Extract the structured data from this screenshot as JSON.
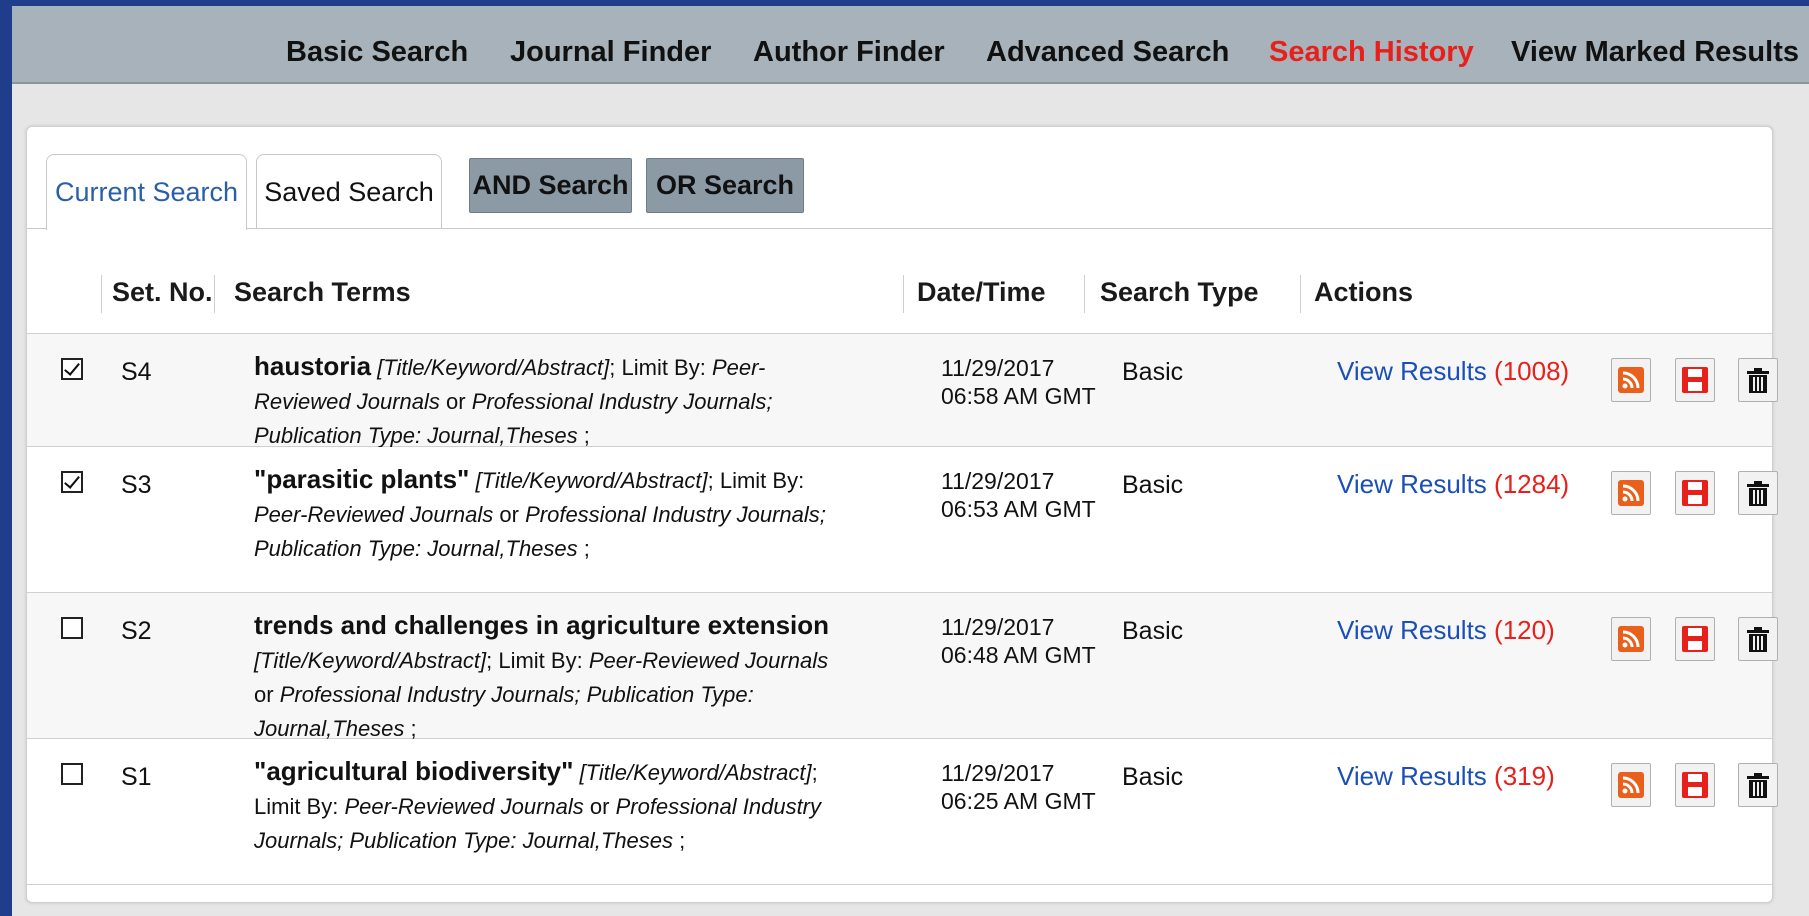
{
  "nav": {
    "items": [
      {
        "label": "Basic Search"
      },
      {
        "label": "Journal Finder"
      },
      {
        "label": "Author Finder"
      },
      {
        "label": "Advanced Search"
      },
      {
        "label": "Search History"
      },
      {
        "label": "View Marked Results"
      }
    ],
    "active": "Search History"
  },
  "tabs": {
    "current": "Current Search",
    "saved": "Saved Search",
    "and_button": "AND Search",
    "or_button": "OR Search"
  },
  "table": {
    "headers": {
      "set_no": "Set. No.",
      "search_terms": "Search Terms",
      "datetime": "Date/Time",
      "search_type": "Search Type",
      "actions": "Actions"
    },
    "rows": [
      {
        "checked": true,
        "set": "S4",
        "term": "haustoria",
        "fields": "[Title/Keyword/Abstract]",
        "limit_label": "; Limit By:",
        "limit1": "Peer-Reviewed Journals",
        "or": "or",
        "limit2": "Professional Industry Journals",
        "pubtype": "; Publication Type: Journal,Theses",
        "tail": ";",
        "date": "11/29/2017",
        "time": "06:58 AM GMT",
        "type": "Basic",
        "view": "View Results",
        "count": "(1008)"
      },
      {
        "checked": true,
        "set": "S3",
        "term": "\"parasitic plants\"",
        "fields": "[Title/Keyword/Abstract]",
        "limit_label": "; Limit By:",
        "limit1": "Peer-Reviewed Journals",
        "or": "or",
        "limit2": "Professional Industry Journals",
        "pubtype": "; Publication Type: Journal,Theses",
        "tail": ";",
        "date": "11/29/2017",
        "time": "06:53 AM GMT",
        "type": "Basic",
        "view": "View Results",
        "count": "(1284)"
      },
      {
        "checked": false,
        "set": "S2",
        "term": "trends and challenges in agriculture extension",
        "fields": "[Title/Keyword/Abstract]",
        "limit_label": "; Limit By:",
        "limit1": "Peer-Reviewed Journals",
        "or": "or",
        "limit2": "Professional Industry Journals",
        "pubtype": "; Publication Type: Journal,Theses",
        "tail": ";",
        "date": "11/29/2017",
        "time": "06:48 AM GMT",
        "type": "Basic",
        "view": "View Results",
        "count": "(120)"
      },
      {
        "checked": false,
        "set": "S1",
        "term": "\"agricultural biodiversity\"",
        "fields": "[Title/Keyword/Abstract]",
        "limit_label": "; Limit By:",
        "limit1": "Peer-Reviewed Journals",
        "or": "or",
        "limit2": "Professional Industry Journals",
        "pubtype": "; Publication Type: Journal,Theses",
        "tail": ";",
        "date": "11/29/2017",
        "time": "06:25 AM GMT",
        "type": "Basic",
        "view": "View Results",
        "count": "(319)"
      }
    ],
    "action_icons": [
      "rss-icon",
      "save-icon",
      "trash-icon"
    ]
  },
  "colors": {
    "border_blue": "#1f3d8a",
    "nav_bg": "#a7b2ba",
    "active_red": "#e8201b",
    "link_blue": "#1a4fb8",
    "rss_orange": "#e8601b",
    "button_gray": "#8c9aa6"
  }
}
